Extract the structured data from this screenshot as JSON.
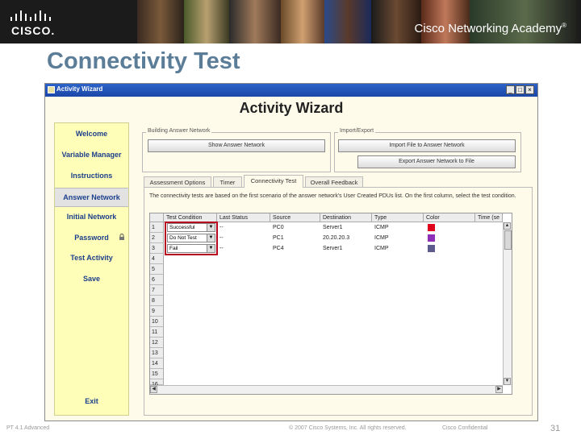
{
  "header": {
    "cisco_wordmark": "CISCO.",
    "academy": "Cisco Networking Academy",
    "academy_mark": "®"
  },
  "slide": {
    "title": "Connectivity Test"
  },
  "window": {
    "title": "Activity Wizard",
    "heading": "Activity Wizard",
    "controls": {
      "minimize": "_",
      "maximize": "□",
      "close": "×"
    }
  },
  "sidebar": {
    "items": [
      {
        "label": "Welcome"
      },
      {
        "label": "Variable Manager"
      },
      {
        "label": "Instructions"
      },
      {
        "label": "Answer Network"
      },
      {
        "label": "Initial Network"
      },
      {
        "label": "Password"
      },
      {
        "label": "Test Activity"
      },
      {
        "label": "Save"
      },
      {
        "label": "Exit"
      }
    ],
    "active": "Answer Network"
  },
  "building": {
    "label": "Building Answer Network",
    "show_button": "Show Answer Network"
  },
  "import_export": {
    "label": "Import/Export",
    "import_button": "Import File to Answer Network",
    "export_button": "Export Answer Network to File"
  },
  "tabs": [
    {
      "label": "Assessment Options"
    },
    {
      "label": "Timer"
    },
    {
      "label": "Connectivity Test"
    },
    {
      "label": "Overall Feedback"
    }
  ],
  "active_tab": "Connectivity Test",
  "description": "The connectivity tests are based on the first scenario of the answer network's User Created PDUs list. On the first column, select the test condition.",
  "grid": {
    "columns": [
      "Test Condition",
      "Last Status",
      "Source",
      "Destination",
      "Type",
      "Color",
      "Time (se"
    ],
    "rows": [
      {
        "num": "1",
        "condition": "Successful",
        "status": "--",
        "source": "PC0",
        "destination": "Server1",
        "type": "ICMP",
        "color": "#e0001b"
      },
      {
        "num": "2",
        "condition": "Do Not Test",
        "status": "--",
        "source": "PC1",
        "destination": "20.20.20.3",
        "type": "ICMP",
        "color": "#8e2fb8"
      },
      {
        "num": "3",
        "condition": "Fail",
        "status": "--",
        "source": "PC4",
        "destination": "Server1",
        "type": "ICMP",
        "color": "#5d5b8e"
      }
    ],
    "empty_row_numbers": [
      "4",
      "5",
      "6",
      "7",
      "8",
      "9",
      "10",
      "11",
      "12",
      "13",
      "14",
      "15",
      "16"
    ],
    "dropdown_arrow": "▼",
    "scroll_up": "▲",
    "scroll_down": "▼",
    "scroll_left": "◀",
    "scroll_right": "▶"
  },
  "footer": {
    "left": "PT 4.1 Advanced",
    "center": "© 2007 Cisco Systems, Inc. All rights reserved.",
    "right": "Cisco Confidential",
    "page": "31"
  },
  "icons": {
    "logo": "cisco-logo-bars",
    "lock": "lock-icon"
  }
}
